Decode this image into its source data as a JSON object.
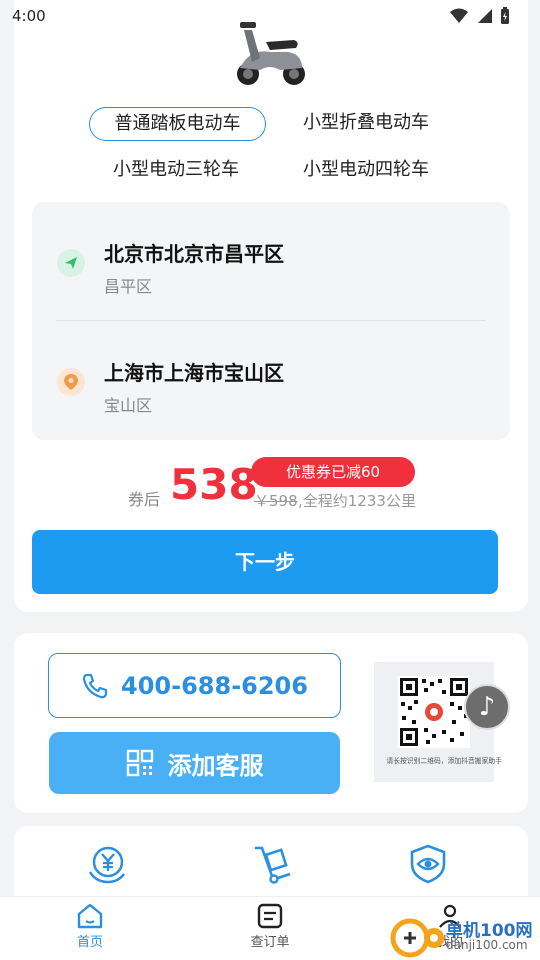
{
  "status_bar": {
    "time": "4:00"
  },
  "vehicle_types": [
    {
      "label": "普通踏板电动车",
      "selected": true
    },
    {
      "label": "小型折叠电动车",
      "selected": false
    },
    {
      "label": "小型电动三轮车",
      "selected": false
    },
    {
      "label": "小型电动四轮车",
      "selected": false
    }
  ],
  "route": {
    "origin": {
      "city": "北京市北京市昌平区",
      "district": "昌平区"
    },
    "destination": {
      "city": "上海市上海市宝山区",
      "district": "宝山区"
    }
  },
  "price": {
    "prefix": "券后",
    "value": "538",
    "coupon": "优惠券已减60",
    "original": "￥598",
    "note": ",全程约1233公里"
  },
  "next_button": "下一步",
  "contact": {
    "phone": "400-688-6206",
    "service_label": "添加客服",
    "qr_caption": "请长按识别二维码，添加抖音搬家助手"
  },
  "bottom_nav": [
    {
      "label": "首页",
      "active": true
    },
    {
      "label": "查订单",
      "active": false
    },
    {
      "label": "我的",
      "active": false
    }
  ],
  "watermark": {
    "line1": "单机100网",
    "line2": "danji100.com"
  },
  "colors": {
    "accent": "#1d9bf0",
    "price_red": "#f0303c",
    "green": "#2fbf71",
    "orange": "#f39a4a"
  }
}
